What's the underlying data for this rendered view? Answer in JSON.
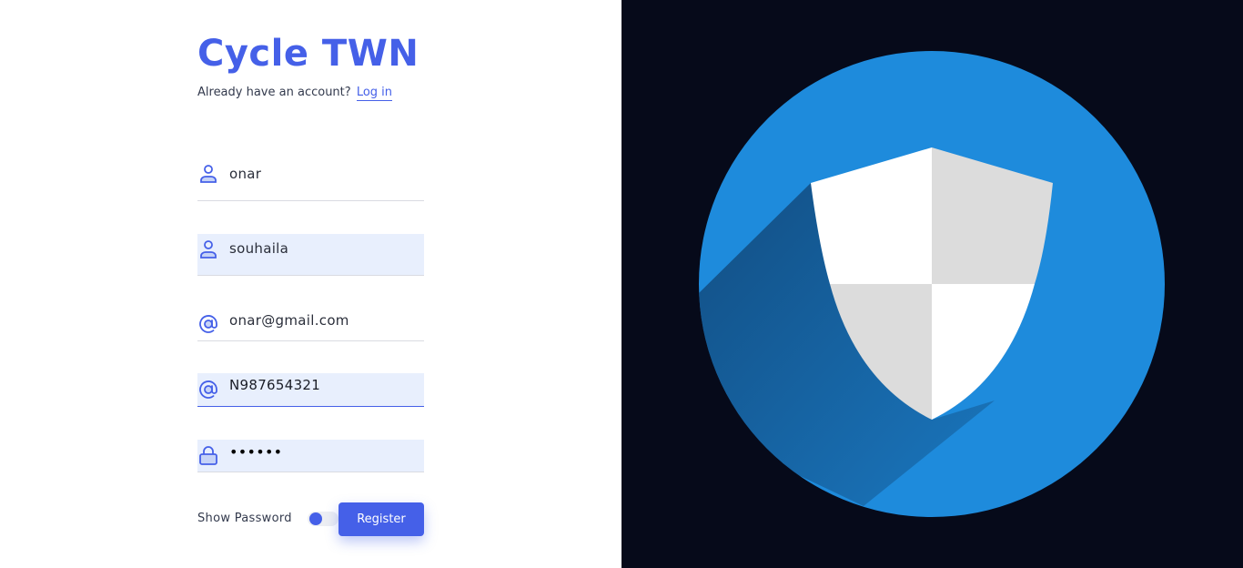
{
  "app": {
    "title": "Cycle TWN",
    "subtitle_prefix": "Already have an account?",
    "login_link": "Log in"
  },
  "form": {
    "fields": [
      {
        "name": "first-name",
        "icon": "user-icon",
        "value": "onar",
        "filled": false
      },
      {
        "name": "last-name",
        "icon": "user-icon",
        "value": "souhaila",
        "filled": true
      },
      {
        "name": "email",
        "icon": "at-icon",
        "value": "onar@gmail.com",
        "filled": false
      },
      {
        "name": "identifier",
        "icon": "at-icon",
        "value": "N987654321",
        "filled": true
      },
      {
        "name": "password",
        "icon": "lock-icon",
        "value": "••••••",
        "filled": true
      }
    ],
    "show_password_label": "Show Password",
    "show_password_on": false,
    "register_label": "Register"
  },
  "colors": {
    "accent": "#4560e8",
    "filled_bg": "#e8effd",
    "right_bg": "#060a1a",
    "circle": "#1e8bdc",
    "shield_white": "#ffffff",
    "shield_gray": "#dcdcdc"
  },
  "illustration": {
    "icon": "shield-icon"
  }
}
